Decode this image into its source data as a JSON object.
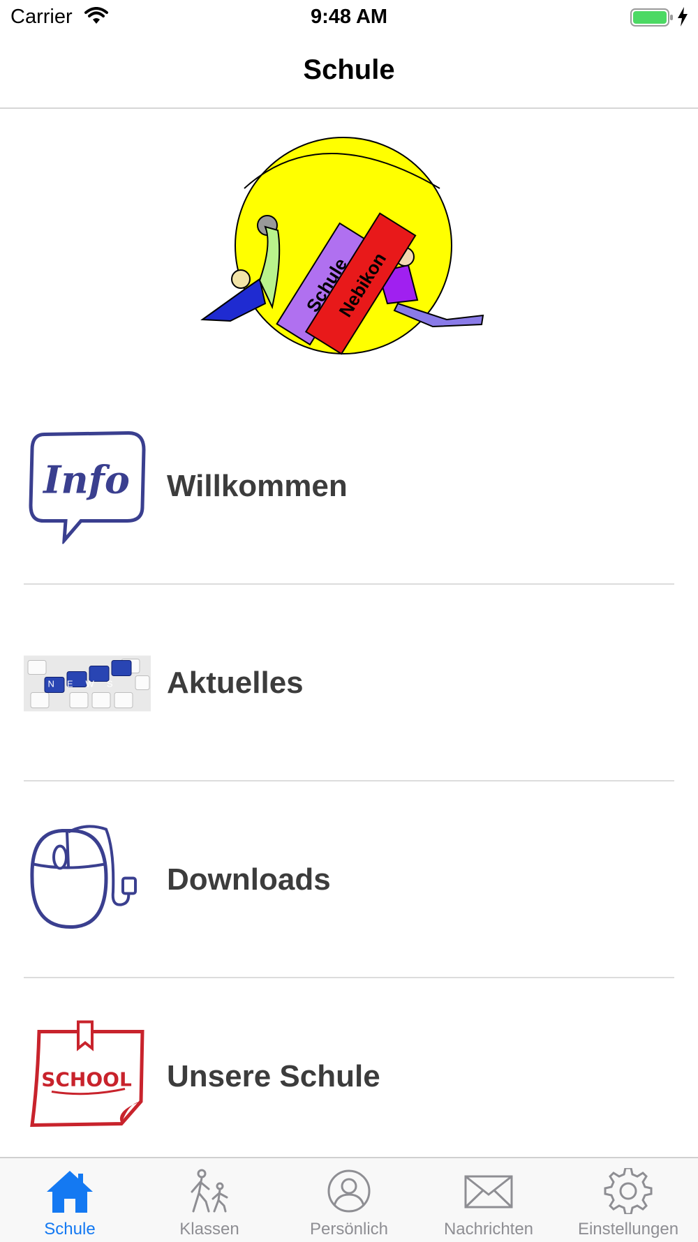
{
  "status_bar": {
    "carrier": "Carrier",
    "time": "9:48 AM"
  },
  "nav": {
    "title": "Schule"
  },
  "logo": {
    "book1": "Schule",
    "book2": "Nebikon"
  },
  "menu": [
    {
      "label": "Willkommen",
      "icon": "info-speech-bubble-icon",
      "icon_text": "Info"
    },
    {
      "label": "Aktuelles",
      "icon": "news-keyboard-icon",
      "icon_text": "NEWS"
    },
    {
      "label": "Downloads",
      "icon": "computer-mouse-icon"
    },
    {
      "label": "Unsere Schule",
      "icon": "school-note-icon",
      "icon_text": "SCHOOL"
    }
  ],
  "tabs": [
    {
      "label": "Schule",
      "icon": "house-icon",
      "active": true
    },
    {
      "label": "Klassen",
      "icon": "walking-people-icon",
      "active": false
    },
    {
      "label": "Persönlich",
      "icon": "person-icon",
      "active": false
    },
    {
      "label": "Nachrichten",
      "icon": "envelope-icon",
      "active": false
    },
    {
      "label": "Einstellungen",
      "icon": "gear-icon",
      "active": false
    }
  ],
  "colors": {
    "accent": "#1479f2",
    "inactive": "#8e8e93",
    "icon_blue": "#3a3f8f",
    "icon_red": "#c8232c",
    "logo_yellow": "#ffff00"
  }
}
